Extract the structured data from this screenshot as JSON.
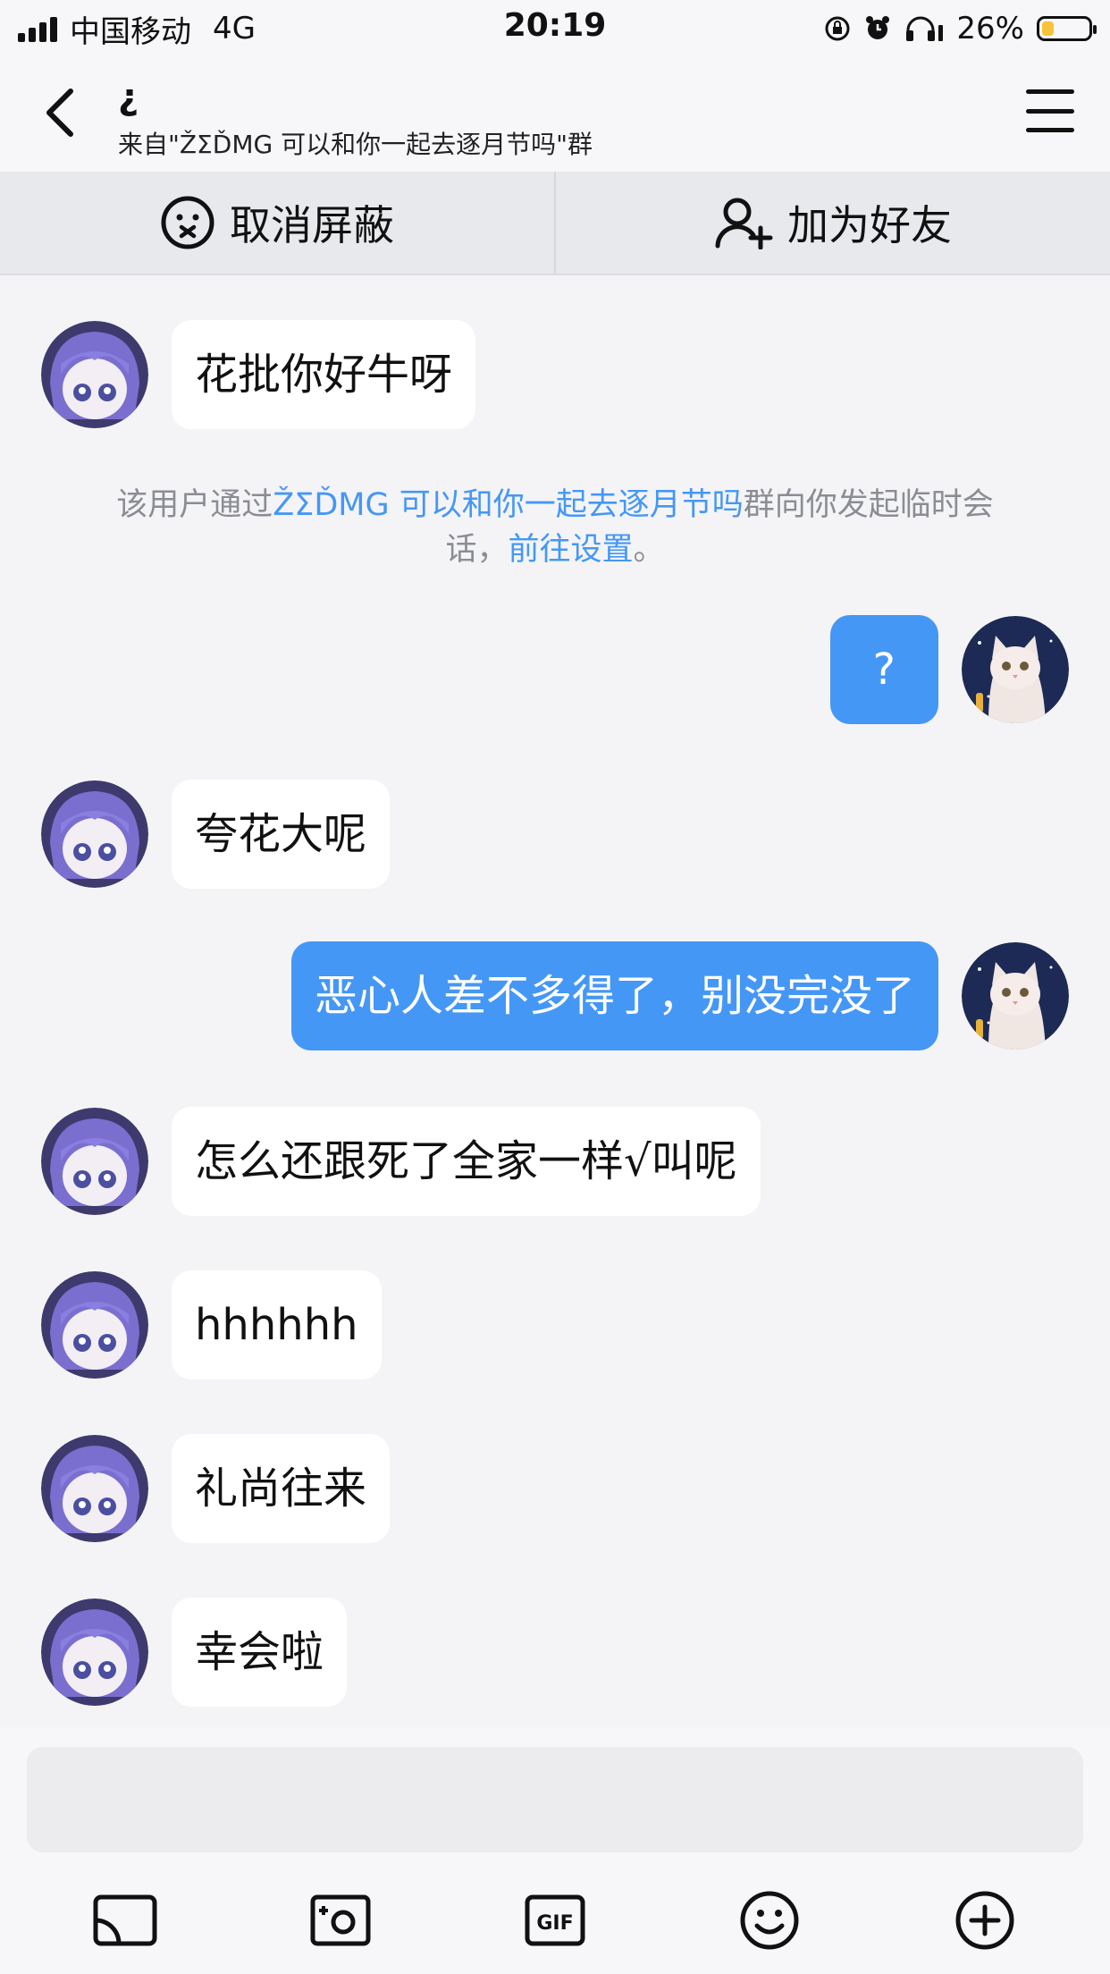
{
  "status_bar": {
    "carrier": "中国移动",
    "network": "4G",
    "time": "20:19",
    "battery_percent": "26%",
    "battery_level": 0.26
  },
  "header": {
    "title": "¿",
    "subtitle": "来自\"ŽΣĎMG 可以和你一起去逐月节吗\"群"
  },
  "actions": {
    "unblock_label": "取消屏蔽",
    "add_friend_label": "加为好友"
  },
  "messages": [
    {
      "side": "left",
      "text": "花批你好牛呀"
    },
    {
      "side": "right",
      "text": "?"
    },
    {
      "side": "left",
      "text": "夸花大呢"
    },
    {
      "side": "right",
      "text": "恶心人差不多得了，别没完没了"
    },
    {
      "side": "left",
      "text": "怎么还跟死了全家一样√叫呢"
    },
    {
      "side": "left",
      "text": "hhhhhh"
    },
    {
      "side": "left",
      "text": "礼尚往来"
    },
    {
      "side": "left",
      "text": "幸会啦"
    }
  ],
  "system_note": {
    "prefix": "该用户通过",
    "group_link": "ŽΣĎMG 可以和你一起去逐月节吗",
    "middle": "群向你发起临时会话，",
    "settings_link": "前往设置",
    "suffix": "。"
  },
  "colors": {
    "accent": "#4597f5",
    "battery": "#f6c33a",
    "background": "#f4f4f6"
  },
  "toolbar_icons": [
    "screen-cast-icon",
    "camera-icon",
    "gif-icon",
    "emoji-icon",
    "plus-icon"
  ]
}
